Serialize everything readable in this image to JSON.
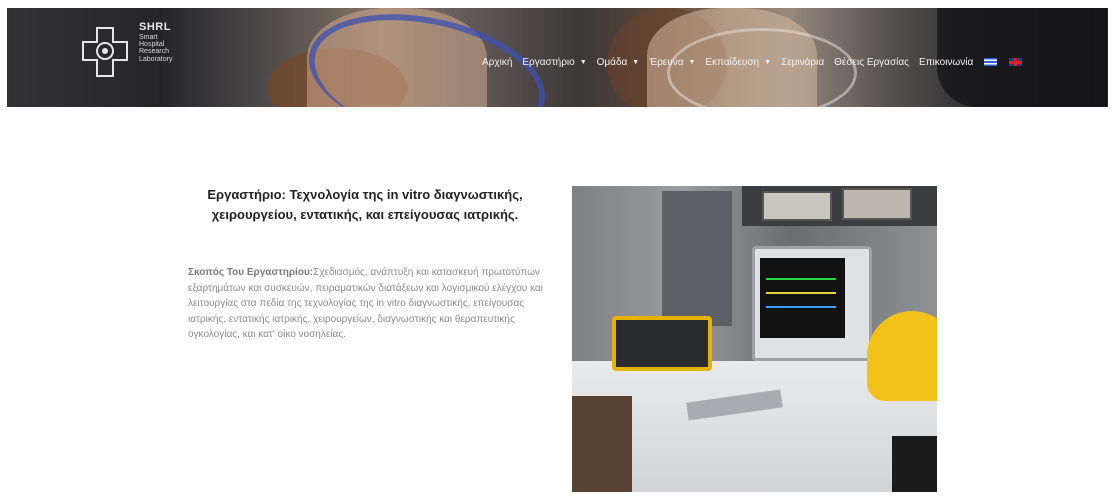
{
  "header": {
    "logo": {
      "title": "SHRL",
      "subtitle_lines": [
        "Smart",
        "Hospital",
        "Research",
        "Laboratory"
      ]
    },
    "nav": [
      {
        "label": "Αρχική",
        "has_dropdown": false
      },
      {
        "label": "Εργαστήριο",
        "has_dropdown": true
      },
      {
        "label": "Ομάδα",
        "has_dropdown": true
      },
      {
        "label": "Έρευνα",
        "has_dropdown": true
      },
      {
        "label": "Εκπαίδευση",
        "has_dropdown": true
      },
      {
        "label": "Σεμινάρια",
        "has_dropdown": false
      },
      {
        "label": "Θέσεις Εργασίας",
        "has_dropdown": false
      },
      {
        "label": "Επικοινωνία",
        "has_dropdown": false
      }
    ],
    "languages": [
      "greek-flag-icon",
      "uk-flag-icon"
    ]
  },
  "main": {
    "heading_line1": "Εργαστήριο: Τεχνολογία της in vitro διαγνωστικής,",
    "heading_line2": "χειρουργείου, εντατικής, και επείγουσας ιατρικής.",
    "purpose_label": "Σκοπός Του Εργαστηρίου:",
    "purpose_text": "Σχεδιασμός, ανάπτυξη και κατασκευή πρωτοτύπων εξαρτημάτων και συσκευών, πειραματικών διατάξεων και λογισμικού ελέγχου και λειτουργίας στα πεδία της τεχνολογίας της in vitro διαγνωστικής, επείγουσας ιατρικής, εντατικής ιατρικής, χειρουργείων, διαγνωστικής και θεραπευτικής ογκολογίας, και κατ' οίκο νοσηλείας."
  },
  "colors": {
    "nav_text": "#f2f2f2",
    "heading": "#222222",
    "body_text": "#8a8a8a",
    "background": "#ffffff"
  }
}
